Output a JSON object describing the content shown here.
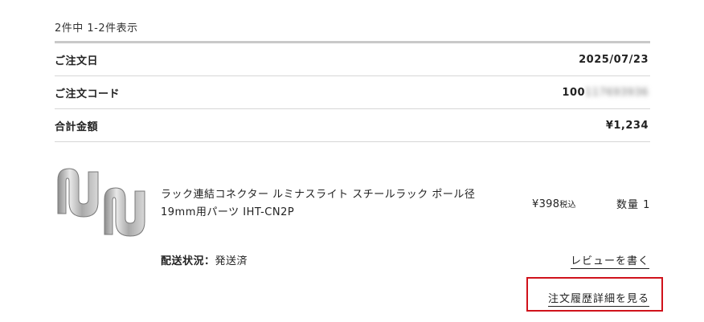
{
  "list": {
    "result_count": "2件中 1-2件表示"
  },
  "order": {
    "date_label": "ご注文日",
    "date_value": "2025/07/23",
    "code_label": "ご注文コード",
    "code_visible": "100",
    "code_hidden": "117693936",
    "total_label": "合計金額",
    "total_value": "¥1,234"
  },
  "item": {
    "name": "ラック連結コネクター ルミナスライト スチールラック ポール径19mm用パーツ IHT-CN2P",
    "price": "¥398",
    "tax_note": "税込",
    "quantity": "数量 1",
    "shipping_label": "配送状況：",
    "shipping_status": "発送済",
    "image_icon": "product-connector-image"
  },
  "actions": {
    "review_label": "レビューを書く",
    "detail_label": "注文履歴詳細を見る"
  },
  "colors": {
    "highlight": "#d0121b",
    "divider": "#d6d6d6"
  }
}
